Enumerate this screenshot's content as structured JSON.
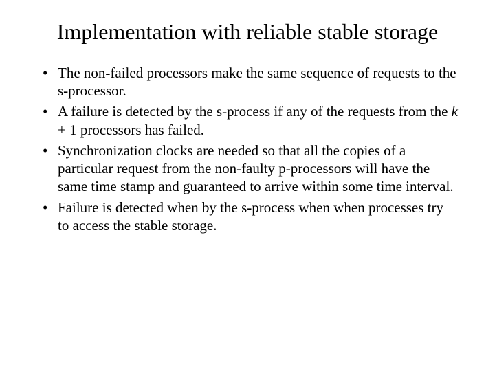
{
  "title": "Implementation with reliable stable storage",
  "bullets": [
    {
      "prefix": "The non-failed processors make the same sequence of requests to the s-processor.",
      "italic": "",
      "suffix": ""
    },
    {
      "prefix": "A failure is detected by the s-process if any of the requests from the ",
      "italic": "k",
      "suffix": " + 1 processors has failed."
    },
    {
      "prefix": "Synchronization clocks are needed so that all the copies of a particular request from the non-faulty p-processors will have the same time stamp and guaranteed to arrive within some time interval.",
      "italic": "",
      "suffix": ""
    },
    {
      "prefix": "Failure is detected when by the s-process when when processes try to access the stable storage.",
      "italic": "",
      "suffix": ""
    }
  ]
}
